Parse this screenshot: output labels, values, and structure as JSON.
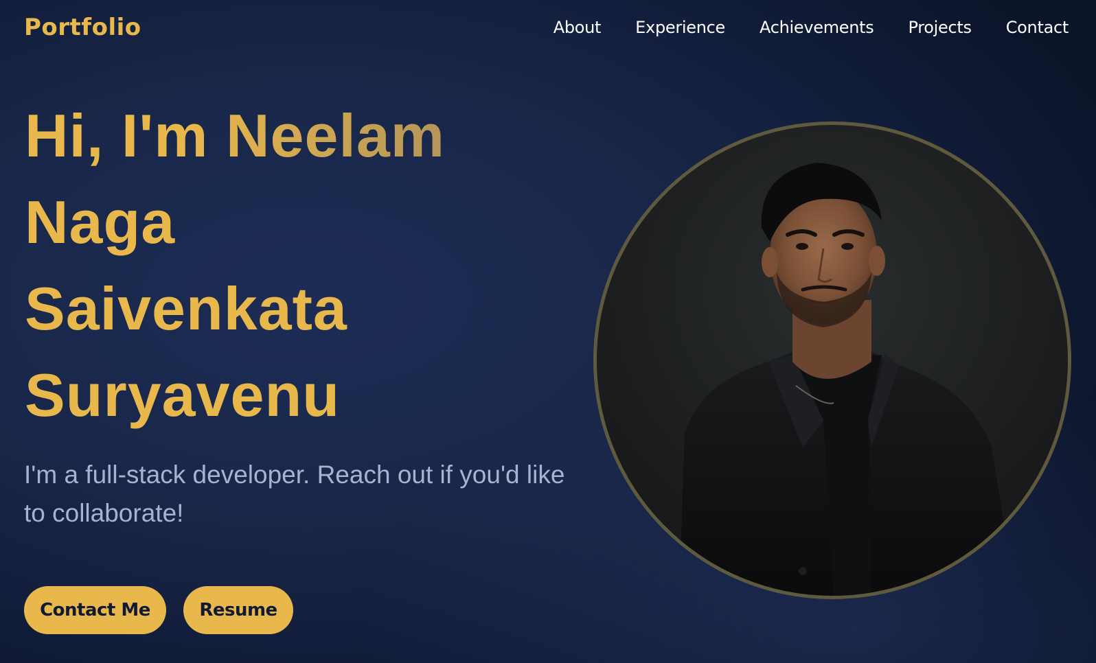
{
  "nav": {
    "logo": "Portfolio",
    "links": [
      "About",
      "Experience",
      "Achievements",
      "Projects",
      "Contact"
    ]
  },
  "hero": {
    "title_lines": [
      "Hi, I'm Neelam",
      "Naga",
      "Saivenkata",
      "Suryavenu"
    ],
    "subtitle": "I'm a full-stack developer. Reach out if you'd like to collaborate!",
    "buttons": {
      "contact": "Contact Me",
      "resume": "Resume"
    }
  },
  "colors": {
    "accent": "#e9b84c",
    "background": "#182648",
    "subtitle_text": "#a7b3cf",
    "portrait_ring": "#5f5a3e"
  }
}
